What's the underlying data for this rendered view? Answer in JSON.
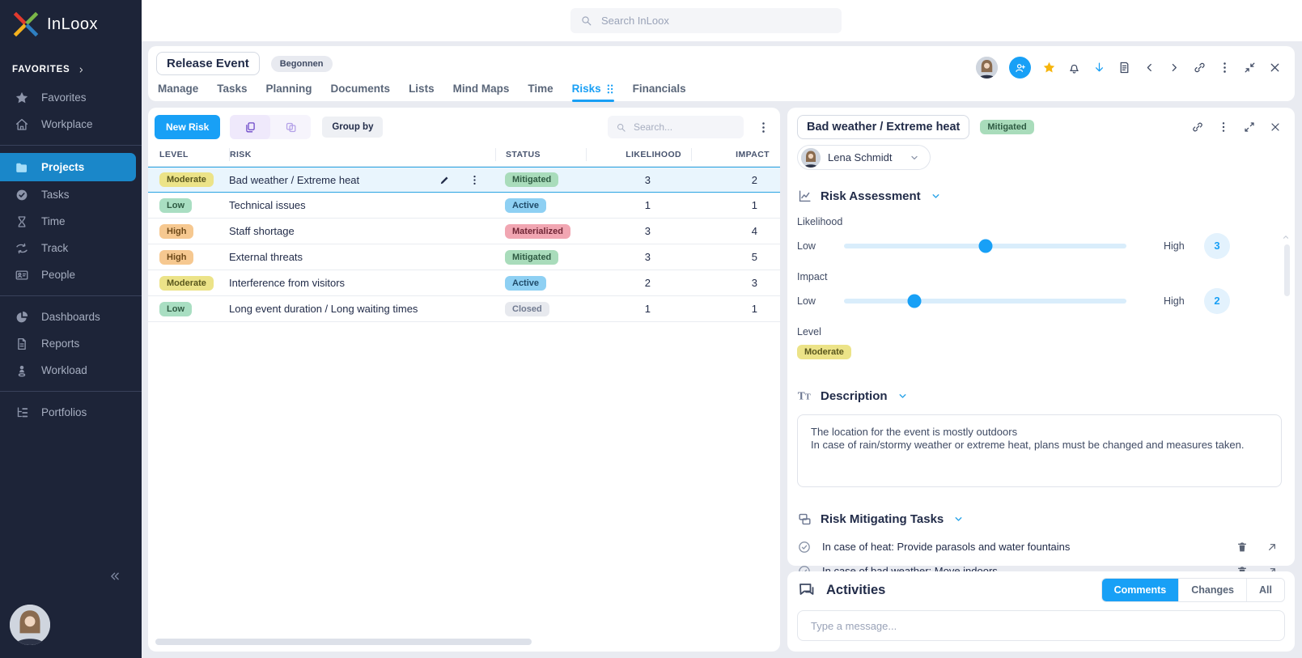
{
  "colors": {
    "primary": "#18a0f6",
    "sidebar_bg": "#1d2438",
    "sidebar_active_bg": "#1a87c9",
    "page_bg": "#e9ebf1",
    "badges": {
      "Low": {
        "bg": "#a9dec2",
        "fg": "#2f5b43"
      },
      "Moderate": {
        "bg": "#ece388",
        "fg": "#5a571d"
      },
      "High": {
        "bg": "#f6c890",
        "fg": "#6e4a1a"
      },
      "Mitigated": {
        "bg": "#a9dcbb",
        "fg": "#2f5b43"
      },
      "Active": {
        "bg": "#8ed0f3",
        "fg": "#1f4a68"
      },
      "Materialized": {
        "bg": "#f1a6b2",
        "fg": "#702636"
      },
      "Closed": {
        "bg": "#e7e9ee",
        "fg": "#707a90"
      }
    }
  },
  "brand": {
    "name": "InLoox"
  },
  "sidebar": {
    "section_label": "FAVORITES",
    "items": [
      {
        "label": "Favorites",
        "icon": "star-icon",
        "group": 0
      },
      {
        "label": "Workplace",
        "icon": "home-icon",
        "group": 0
      },
      {
        "label": "Projects",
        "icon": "projects-icon",
        "group": 1,
        "active": true
      },
      {
        "label": "Tasks",
        "icon": "tasks-icon",
        "group": 1
      },
      {
        "label": "Time",
        "icon": "hourglass-icon",
        "group": 1
      },
      {
        "label": "Track",
        "icon": "track-icon",
        "group": 1
      },
      {
        "label": "People",
        "icon": "people-icon",
        "group": 1
      },
      {
        "label": "Dashboards",
        "icon": "dashboard-icon",
        "group": 2
      },
      {
        "label": "Reports",
        "icon": "reports-icon",
        "group": 2
      },
      {
        "label": "Workload",
        "icon": "workload-icon",
        "group": 2
      },
      {
        "label": "Portfolios",
        "icon": "portfolios-icon",
        "group": 3
      }
    ]
  },
  "topbar": {
    "search_placeholder": "Search InLoox"
  },
  "project_header": {
    "title": "Release Event",
    "status_badge": "Begonnen",
    "tabs": [
      {
        "label": "Manage"
      },
      {
        "label": "Tasks"
      },
      {
        "label": "Planning"
      },
      {
        "label": "Documents"
      },
      {
        "label": "Lists"
      },
      {
        "label": "Mind Maps"
      },
      {
        "label": "Time"
      },
      {
        "label": "Risks",
        "active": true
      },
      {
        "label": "Financials"
      }
    ]
  },
  "risk_list": {
    "new_risk_button": "New Risk",
    "group_by_button": "Group by",
    "search_placeholder": "Search...",
    "columns": [
      "LEVEL",
      "RISK",
      "STATUS",
      "LIKELIHOOD",
      "IMPACT"
    ],
    "rows": [
      {
        "level": "Moderate",
        "risk": "Bad weather / Extreme heat",
        "status": "Mitigated",
        "likelihood": 3,
        "impact": 2,
        "selected": true
      },
      {
        "level": "Low",
        "risk": "Technical issues",
        "status": "Active",
        "likelihood": 1,
        "impact": 1
      },
      {
        "level": "High",
        "risk": "Staff shortage",
        "status": "Materialized",
        "likelihood": 3,
        "impact": 4
      },
      {
        "level": "High",
        "risk": "External threats",
        "status": "Mitigated",
        "likelihood": 3,
        "impact": 5
      },
      {
        "level": "Moderate",
        "risk": "Interference from visitors",
        "status": "Active",
        "likelihood": 2,
        "impact": 3
      },
      {
        "level": "Low",
        "risk": "Long event duration / Long waiting times",
        "status": "Closed",
        "likelihood": 1,
        "impact": 1
      }
    ]
  },
  "detail_panel": {
    "title": "Bad weather / Extreme heat",
    "status_badge": "Mitigated",
    "owner": "Lena Schmidt",
    "risk_assessment": {
      "heading": "Risk Assessment",
      "likelihood": {
        "label": "Likelihood",
        "min_label": "Low",
        "max_label": "High",
        "value": 3,
        "min": 1,
        "max": 5
      },
      "impact": {
        "label": "Impact",
        "min_label": "Low",
        "max_label": "High",
        "value": 2,
        "min": 1,
        "max": 5
      },
      "level_label": "Level",
      "level_value": "Moderate"
    },
    "description": {
      "heading": "Description",
      "lines": [
        "The location for the event is mostly outdoors",
        "In case of rain/stormy weather or extreme heat, plans must be changed and measures taken."
      ]
    },
    "mitigating_tasks": {
      "heading": "Risk Mitigating Tasks",
      "items": [
        {
          "text": "In case of heat: Provide parasols and water fountains"
        },
        {
          "text": "In case of bad weather: Move indoors"
        }
      ]
    }
  },
  "activities": {
    "heading": "Activities",
    "filters": [
      {
        "label": "Comments",
        "active": true
      },
      {
        "label": "Changes"
      },
      {
        "label": "All"
      }
    ],
    "message_placeholder": "Type a message..."
  }
}
